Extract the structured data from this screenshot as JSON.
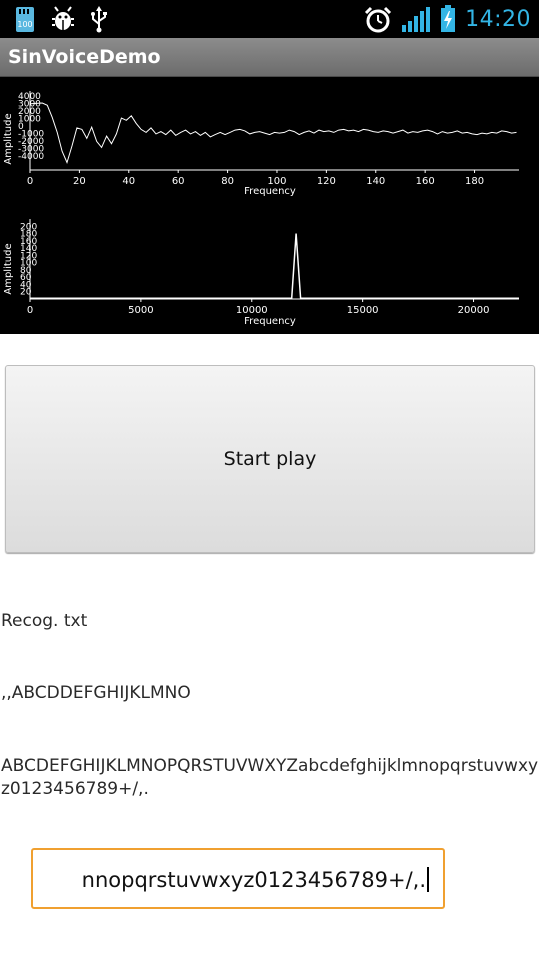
{
  "status_bar": {
    "battery_badge": "100",
    "time": "14:20"
  },
  "app": {
    "title": "SinVoiceDemo"
  },
  "chart_data": [
    {
      "type": "line",
      "xlabel": "Frequency",
      "ylabel": "Amplitude",
      "xlim": [
        0,
        198
      ],
      "ylim": [
        -6000,
        4500
      ],
      "x_ticks": [
        0,
        20,
        40,
        60,
        80,
        100,
        120,
        140,
        160,
        180
      ],
      "y_tick_labels": [
        "4000",
        "3000",
        "2000",
        "1000",
        "0",
        "-1000",
        "-2000",
        "-3000",
        "-4000"
      ],
      "series": [
        {
          "points": [
            [
              0,
              2800
            ],
            [
              5,
              2900
            ],
            [
              7,
              2600
            ],
            [
              9,
              1000
            ],
            [
              11,
              -1000
            ],
            [
              13,
              -3500
            ],
            [
              15,
              -5000
            ],
            [
              17,
              -2800
            ],
            [
              19,
              -400
            ],
            [
              21,
              -600
            ],
            [
              23,
              -1800
            ],
            [
              25,
              -300
            ],
            [
              27,
              -2200
            ],
            [
              29,
              -3000
            ],
            [
              31,
              -1500
            ],
            [
              33,
              -2500
            ],
            [
              35,
              -1200
            ],
            [
              37,
              900
            ],
            [
              39,
              600
            ],
            [
              41,
              1200
            ],
            [
              43,
              200
            ],
            [
              45,
              -600
            ],
            [
              47,
              -1000
            ],
            [
              49,
              -400
            ],
            [
              51,
              -1200
            ],
            [
              53,
              -900
            ],
            [
              55,
              -1300
            ],
            [
              57,
              -700
            ],
            [
              59,
              -1400
            ],
            [
              61,
              -1000
            ],
            [
              63,
              -700
            ],
            [
              65,
              -1200
            ],
            [
              67,
              -900
            ],
            [
              69,
              -1400
            ],
            [
              71,
              -1000
            ],
            [
              73,
              -1600
            ],
            [
              75,
              -1300
            ],
            [
              77,
              -1000
            ],
            [
              79,
              -1300
            ],
            [
              81,
              -1000
            ],
            [
              83,
              -700
            ],
            [
              85,
              -600
            ],
            [
              87,
              -800
            ],
            [
              89,
              -1200
            ],
            [
              91,
              -1000
            ],
            [
              93,
              -900
            ],
            [
              95,
              -1100
            ],
            [
              97,
              -1300
            ],
            [
              99,
              -1000
            ],
            [
              101,
              -1100
            ],
            [
              103,
              -1000
            ],
            [
              105,
              -700
            ],
            [
              107,
              -900
            ],
            [
              109,
              -1300
            ],
            [
              111,
              -1000
            ],
            [
              113,
              -800
            ],
            [
              115,
              -1100
            ],
            [
              117,
              -700
            ],
            [
              119,
              -900
            ],
            [
              121,
              -800
            ],
            [
              123,
              -1000
            ],
            [
              125,
              -700
            ],
            [
              127,
              -600
            ],
            [
              129,
              -800
            ],
            [
              131,
              -700
            ],
            [
              133,
              -900
            ],
            [
              135,
              -600
            ],
            [
              137,
              -700
            ],
            [
              139,
              -900
            ],
            [
              141,
              -1000
            ],
            [
              143,
              -800
            ],
            [
              145,
              -900
            ],
            [
              147,
              -1100
            ],
            [
              149,
              -900
            ],
            [
              151,
              -700
            ],
            [
              153,
              -1100
            ],
            [
              155,
              -900
            ],
            [
              157,
              -1000
            ],
            [
              159,
              -800
            ],
            [
              161,
              -700
            ],
            [
              163,
              -900
            ],
            [
              165,
              -1200
            ],
            [
              167,
              -900
            ],
            [
              169,
              -1100
            ],
            [
              171,
              -1000
            ],
            [
              173,
              -800
            ],
            [
              175,
              -1100
            ],
            [
              177,
              -1000
            ],
            [
              179,
              -1200
            ],
            [
              181,
              -1300
            ],
            [
              183,
              -1100
            ],
            [
              185,
              -1200
            ],
            [
              187,
              -1000
            ],
            [
              189,
              -1100
            ],
            [
              191,
              -800
            ],
            [
              193,
              -900
            ],
            [
              195,
              -1100
            ],
            [
              197,
              -1000
            ]
          ]
        }
      ]
    },
    {
      "type": "line",
      "xlabel": "Frequency",
      "ylabel": "Amplitude",
      "xlim": [
        0,
        22050
      ],
      "ylim": [
        0,
        220
      ],
      "x_ticks": [
        0,
        5000,
        10000,
        15000,
        20000
      ],
      "y_ticks": [
        20,
        40,
        60,
        80,
        100,
        120,
        140,
        160,
        180,
        200
      ],
      "series": [
        {
          "points": [
            [
              0,
              2
            ],
            [
              11800,
              2
            ],
            [
              12000,
              180
            ],
            [
              12200,
              2
            ],
            [
              22050,
              2
            ]
          ]
        }
      ]
    }
  ],
  "controls": {
    "start_button_label": "Start play"
  },
  "texts": {
    "recog_label": "Recog. txt",
    "recog_result": ",,ABCDDEFGHIJKLMNO",
    "source_text": "ABCDEFGHIJKLMNOPQRSTUVWXYZabcdefghijklmnopqrstuvwxyz0123456789+/,."
  },
  "input": {
    "value": "nnopqrstuvwxyz0123456789+/,."
  },
  "colors": {
    "status_accent": "#33b5e5",
    "input_focus": "#f0a030",
    "graph_bg": "#000000",
    "graph_line": "#ffffff"
  },
  "icons": [
    "sd-card-icon",
    "android-debug-icon",
    "usb-icon",
    "alarm-clock-icon",
    "signal-strength-icon",
    "battery-charging-icon"
  ]
}
